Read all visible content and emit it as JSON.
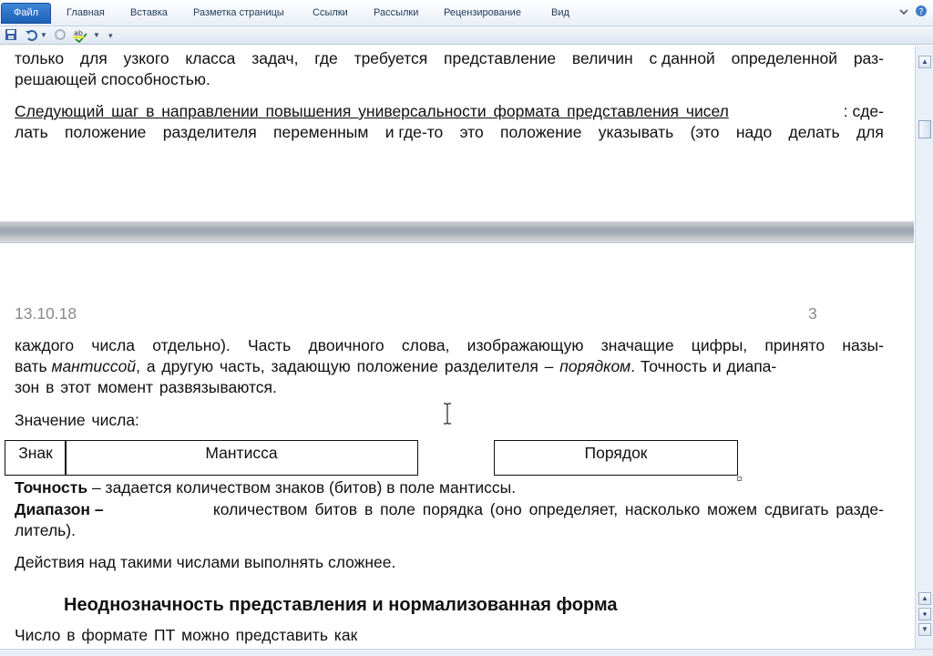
{
  "ribbon": {
    "tabs": [
      "Файл",
      "Главная",
      "Вставка",
      "Разметка страницы",
      "Ссылки",
      "Рассылки",
      "Рецензирование",
      "Вид"
    ],
    "help_icon": "help-icon",
    "collapse_icon": "chevron-down-icon"
  },
  "qat": {
    "icons": [
      "save-icon",
      "undo-icon",
      "redo-icon",
      "spelling-icon",
      "customize-icon"
    ]
  },
  "doc": {
    "page1": {
      "p1_l1": [
        "только",
        "для",
        "узкого",
        "класса",
        "задач,",
        "где",
        "требуется",
        "представление",
        "величин",
        "с данной",
        "определенной",
        "раз-"
      ],
      "p1_l2": "решающей способностью.",
      "p2_l1_underlined": "Следующий шаг в направлении повышения универсальности формата представления чисел",
      "p2_l1_rest": ": сде-",
      "p2_l2": [
        "лать",
        "положение",
        "разделителя",
        "переменным",
        "и где-то",
        "это",
        "положение",
        "указывать",
        "(это",
        "надо",
        "делать",
        "для"
      ]
    },
    "page2": {
      "header_date": "13.10.18",
      "header_page": "3",
      "p1_l1": [
        "каждого",
        "числа",
        "отдельно).",
        "Часть",
        "двоичного",
        "слова,",
        "изображающую",
        "значащие",
        "цифры,",
        "принято",
        "назы-"
      ],
      "p1_l2_a": "вать ",
      "p1_l2_italic1": "мантиссой",
      "p1_l2_b": ", а другую часть, задающую положение разделителя – ",
      "p1_l2_italic2": "порядком",
      "p1_l2_c": ". Точность и диапа-",
      "p1_l3": "зон в этот момент развязываются.",
      "p2": "Значение числа:",
      "table": {
        "sign": "Знак",
        "mantissa": "Мантисса",
        "exponent": "Порядок"
      },
      "precision_bold": "Точность",
      "precision_rest": " – задается количеством знаков (битов) в поле мантиссы.",
      "range_bold": "Диапазон –",
      "range_rest": " количеством битов в поле порядка (оно определяет, насколько можем сдвигать разде-",
      "range_l2": "литель).",
      "p4": "Действия над такими числами выполнять сложнее.",
      "heading": "Неоднозначность представления и нормализованная форма",
      "p5": "Число в формате ПТ можно представить как"
    }
  }
}
